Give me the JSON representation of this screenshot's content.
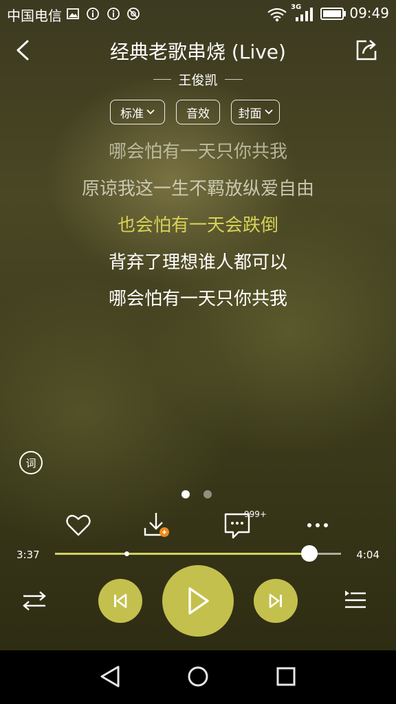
{
  "status_bar": {
    "carrier": "中国电信",
    "network_label": "3G",
    "time": "09:49"
  },
  "header": {
    "title": "经典老歌串烧 (Live)",
    "artist": "王俊凯"
  },
  "chips": {
    "quality": "标准",
    "effects": "音效",
    "cover": "封面"
  },
  "lyrics": [
    "哪会怕有一天只你共我",
    "原谅我这一生不羁放纵爱自由",
    "也会怕有一天会跌倒",
    "背弃了理想谁人都可以",
    "哪会怕有一天只你共我"
  ],
  "lyrics_toggle_label": "词",
  "actions": {
    "comment_count": "999+"
  },
  "player": {
    "elapsed": "3:37",
    "total": "4:04",
    "progress": 0.89,
    "buffered": 0.25
  },
  "colors": {
    "accent": "#c4c04d",
    "highlight_lyric": "#d8d257"
  },
  "icons": {
    "back": "chevron-left-icon",
    "share": "share-icon",
    "like": "heart-icon",
    "download": "download-icon",
    "comment": "comment-icon",
    "more": "more-icon",
    "shuffle": "shuffle-icon",
    "prev": "skip-previous-icon",
    "play": "play-icon",
    "next": "skip-next-icon",
    "playlist": "playlist-icon"
  }
}
